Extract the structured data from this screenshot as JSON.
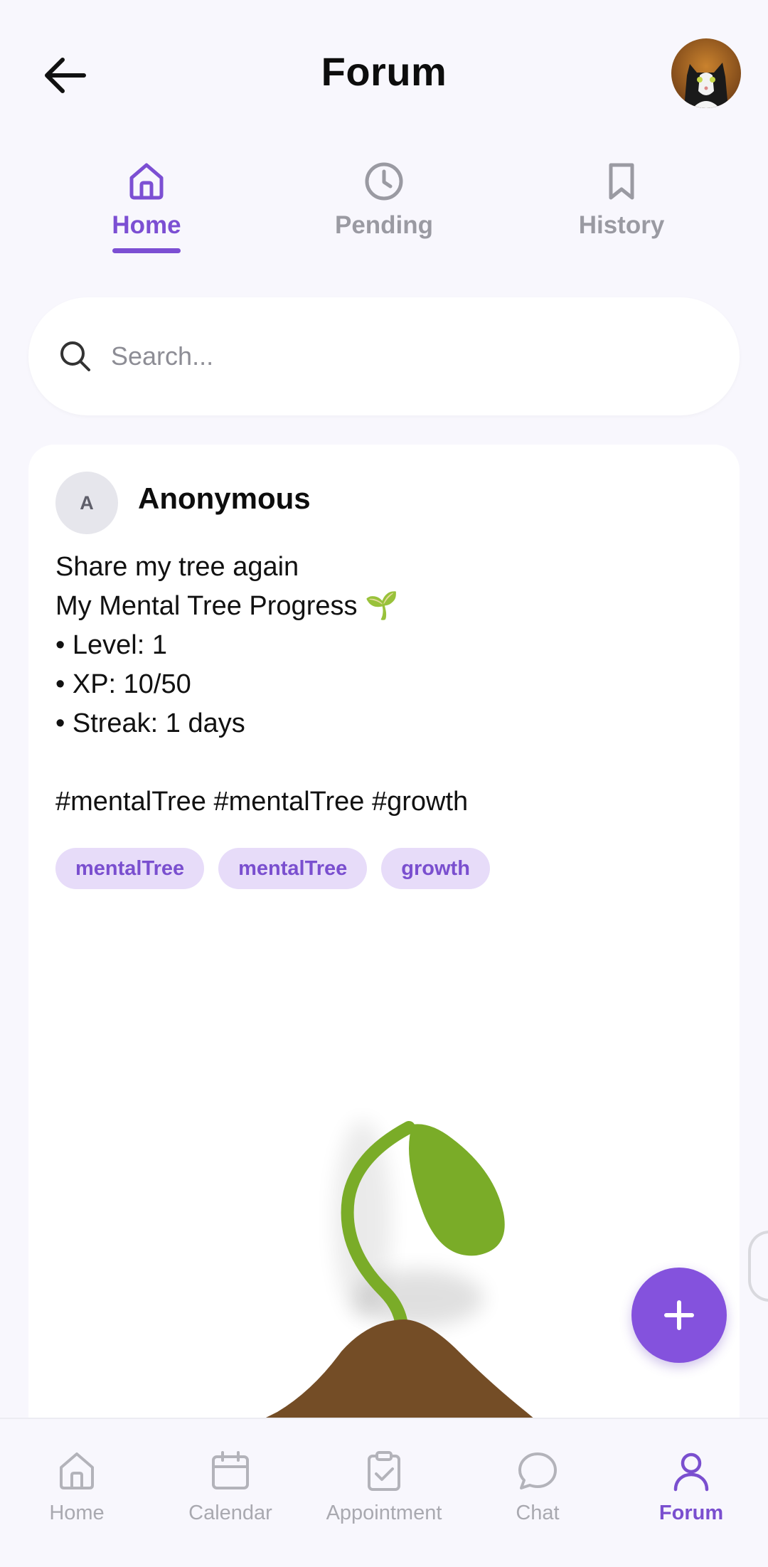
{
  "header": {
    "title": "Forum",
    "back_icon": "arrow-left-icon",
    "avatar_desc": "profile-avatar"
  },
  "tabs": [
    {
      "label": "Home",
      "icon": "home-icon",
      "active": true
    },
    {
      "label": "Pending",
      "icon": "clock-icon",
      "active": false
    },
    {
      "label": "History",
      "icon": "bookmark-icon",
      "active": false
    }
  ],
  "search": {
    "placeholder": "Search..."
  },
  "post": {
    "avatar_initial": "A",
    "author": "Anonymous",
    "lines": [
      "Share my tree again",
      "My Mental Tree Progress 🌱",
      "• Level: 1",
      "• XP: 10/50",
      "• Streak: 1 days",
      "",
      "#mentalTree #mentalTree #growth"
    ],
    "tags": [
      "mentalTree",
      "mentalTree",
      "growth"
    ]
  },
  "fab": {
    "icon": "plus-icon"
  },
  "bottom_nav": [
    {
      "label": "Home",
      "icon": "home-icon",
      "active": false
    },
    {
      "label": "Calendar",
      "icon": "calendar-icon",
      "active": false
    },
    {
      "label": "Appointment",
      "icon": "clipboard-check-icon",
      "active": false
    },
    {
      "label": "Chat",
      "icon": "chat-bubble-icon",
      "active": false
    },
    {
      "label": "Forum",
      "icon": "user-icon",
      "active": true
    }
  ],
  "colors": {
    "accent": "#7c4fd3",
    "background": "#f8f7fd",
    "tag_bg": "#e7dcf9",
    "soil": "#744d26",
    "leaf": "#7aac28"
  }
}
